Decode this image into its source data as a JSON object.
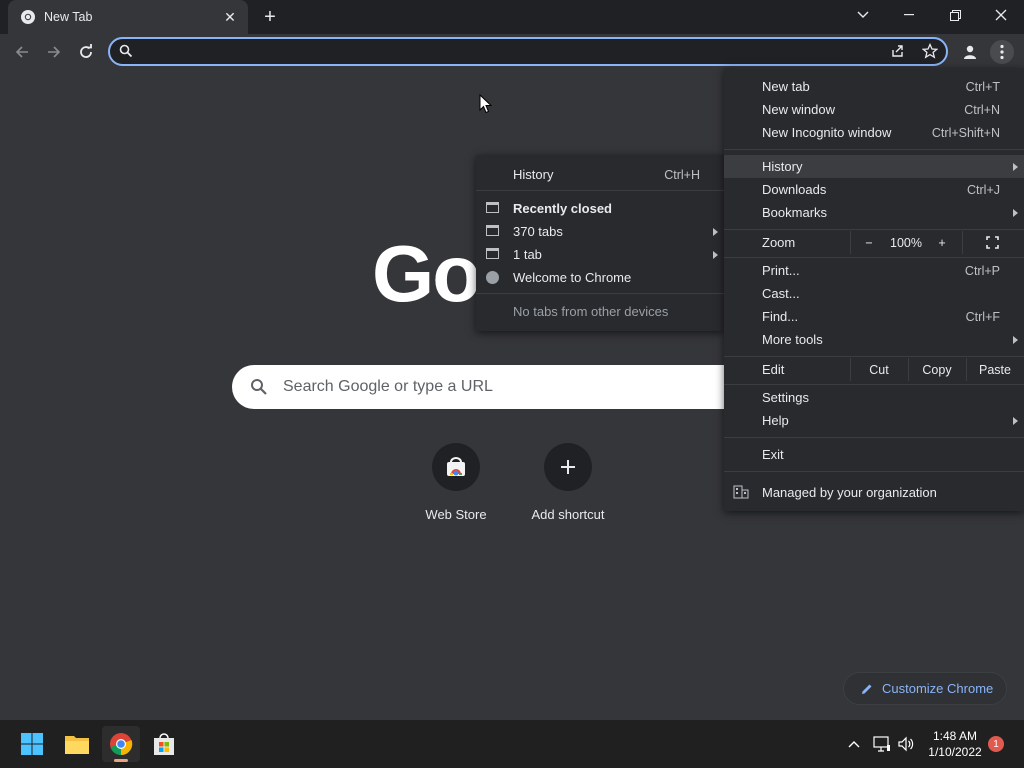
{
  "tab": {
    "title": "New Tab",
    "favicon": "chrome-icon",
    "close": "✕"
  },
  "newtab_symbol": "+",
  "window_controls": {
    "tab_search": "⌄",
    "minimize": "—",
    "restore": "❐",
    "close": "✕"
  },
  "omnibox": {
    "value": "",
    "placeholder": ""
  },
  "ntp": {
    "logo_text": "Go",
    "search_placeholder": "Search Google or type a URL",
    "shortcuts": [
      {
        "label": "Web Store",
        "icon": "web-store-icon"
      },
      {
        "label": "Add shortcut",
        "icon": "plus-icon",
        "symbol": "+"
      }
    ],
    "customize_label": "Customize Chrome"
  },
  "main_menu": {
    "new_tab": {
      "label": "New tab",
      "shortcut": "Ctrl+T"
    },
    "new_window": {
      "label": "New window",
      "shortcut": "Ctrl+N"
    },
    "new_incognito": {
      "label": "New Incognito window",
      "shortcut": "Ctrl+Shift+N"
    },
    "history": {
      "label": "History"
    },
    "downloads": {
      "label": "Downloads",
      "shortcut": "Ctrl+J"
    },
    "bookmarks": {
      "label": "Bookmarks"
    },
    "zoom": {
      "label": "Zoom",
      "minus": "−",
      "level": "100%",
      "plus": "+"
    },
    "print": {
      "label": "Print...",
      "shortcut": "Ctrl+P"
    },
    "cast": {
      "label": "Cast..."
    },
    "find": {
      "label": "Find...",
      "shortcut": "Ctrl+F"
    },
    "more_tools": {
      "label": "More tools"
    },
    "edit": {
      "label": "Edit",
      "cut": "Cut",
      "copy": "Copy",
      "paste": "Paste"
    },
    "settings": {
      "label": "Settings"
    },
    "help": {
      "label": "Help"
    },
    "exit": {
      "label": "Exit"
    },
    "managed": {
      "label": "Managed by your organization"
    }
  },
  "history_menu": {
    "history": {
      "label": "History",
      "shortcut": "Ctrl+H"
    },
    "recently_closed": "Recently closed",
    "items": [
      "370 tabs",
      "1 tab",
      "Welcome to Chrome"
    ],
    "no_tabs": "No tabs from other devices"
  },
  "taskbar": {
    "time": "1:48 AM",
    "date": "1/10/2022",
    "notification_count": "1"
  },
  "colors": {
    "accent": "#8ab4f8",
    "background": "#35363a",
    "menu": "#292a2d",
    "titlebar": "#202124"
  }
}
